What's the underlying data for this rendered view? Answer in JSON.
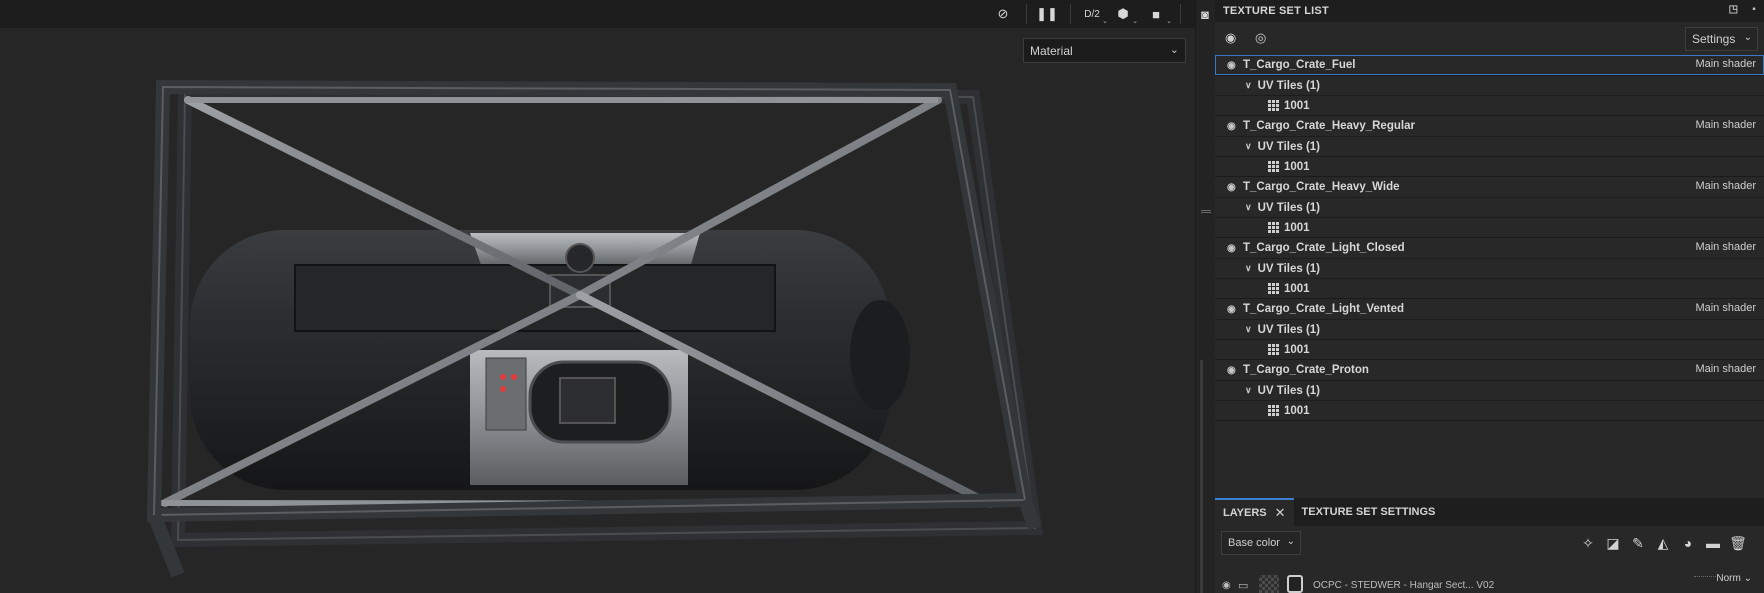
{
  "viewport": {
    "toolbar": {
      "hide_icon": "eye-slash-icon",
      "pause_icon": "pause-icon",
      "dims_label": "D/2",
      "cube_icon": "cube-icon",
      "camera_icon": "video-camera-icon",
      "screenshot_icon": "camera-icon"
    },
    "material_select": {
      "value": "Material"
    }
  },
  "texture_set_list": {
    "title": "TEXTURE SET LIST",
    "settings_label": "Settings",
    "sets": [
      {
        "name": "T_Cargo_Crate_Fuel",
        "shader": "Main shader",
        "uv_label": "UV Tiles (1)",
        "tile": "1001",
        "selected": true
      },
      {
        "name": "T_Cargo_Crate_Heavy_Regular",
        "shader": "Main shader",
        "uv_label": "UV Tiles (1)",
        "tile": "1001",
        "selected": false
      },
      {
        "name": "T_Cargo_Crate_Heavy_Wide",
        "shader": "Main shader",
        "uv_label": "UV Tiles (1)",
        "tile": "1001",
        "selected": false
      },
      {
        "name": "T_Cargo_Crate_Light_Closed",
        "shader": "Main shader",
        "uv_label": "UV Tiles (1)",
        "tile": "1001",
        "selected": false
      },
      {
        "name": "T_Cargo_Crate_Light_Vented",
        "shader": "Main shader",
        "uv_label": "UV Tiles (1)",
        "tile": "1001",
        "selected": false
      },
      {
        "name": "T_Cargo_Crate_Proton",
        "shader": "Main shader",
        "uv_label": "UV Tiles (1)",
        "tile": "1001",
        "selected": false
      }
    ]
  },
  "layers_panel": {
    "tabs": [
      {
        "label": "LAYERS",
        "active": true
      },
      {
        "label": "TEXTURE SET SETTINGS",
        "active": false
      }
    ],
    "channel_select": "Base color",
    "layer": {
      "name": "OCPC - STEDWER - Hangar Sect... V02",
      "blend": "Norm"
    }
  },
  "colors": {
    "accent": "#3d7fd1",
    "viewport_bg": "#262626",
    "panel_bg": "#282828"
  }
}
